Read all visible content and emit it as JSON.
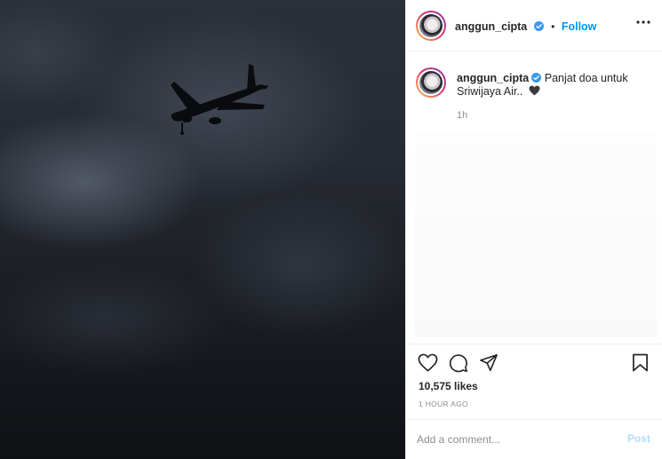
{
  "post": {
    "image_alt": "Airplane silhouette against a dark cloudy sky",
    "author": {
      "username": "anggun_cipta",
      "verified": true
    },
    "header": {
      "separator": "•",
      "follow_label": "Follow"
    },
    "caption": {
      "text": "Panjat doa untuk Sriwijaya Air..",
      "emoji": "black-heart-icon",
      "time": "1h"
    },
    "likes": "10,575 likes",
    "time_ago": "1 HOUR AGO",
    "comment": {
      "placeholder": "Add a comment...",
      "post_label": "Post"
    }
  },
  "colors": {
    "accent": "#0095f6",
    "post_disabled": "#b3dbff",
    "muted": "#8e8e8e",
    "text": "#262626",
    "border": "#efefef"
  }
}
